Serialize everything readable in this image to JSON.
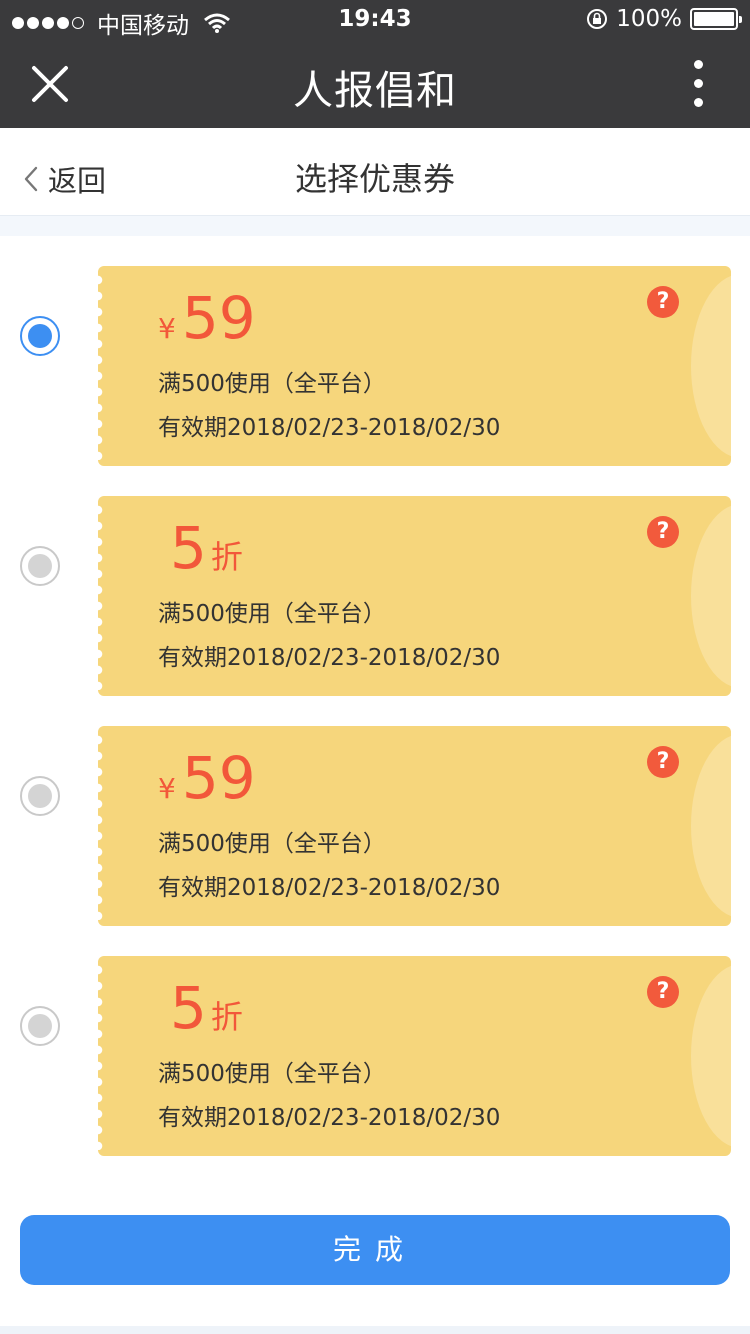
{
  "status_bar": {
    "carrier": "中国移动",
    "time": "19:43",
    "battery": "100%"
  },
  "nav": {
    "title": "人报倡和",
    "close_icon": "close-icon",
    "more_icon": "more-vertical-icon"
  },
  "sub_header": {
    "back_label": "返回",
    "title": "选择优惠券"
  },
  "coupons": [
    {
      "selected": true,
      "currency": "¥",
      "value": "59",
      "unit": "",
      "condition": "满500使用（全平台）",
      "validity": "有效期2018/02/23-2018/02/30"
    },
    {
      "selected": false,
      "currency": "",
      "value": "5",
      "unit": "折",
      "condition": "满500使用（全平台）",
      "validity": "有效期2018/02/23-2018/02/30"
    },
    {
      "selected": false,
      "currency": "¥",
      "value": "59",
      "unit": "",
      "condition": "满500使用（全平台）",
      "validity": "有效期2018/02/23-2018/02/30"
    },
    {
      "selected": false,
      "currency": "",
      "value": "5",
      "unit": "折",
      "condition": "满500使用（全平台）",
      "validity": "有效期2018/02/23-2018/02/30"
    }
  ],
  "help_symbol": "?",
  "done_label": "完成",
  "colors": {
    "bar_bg": "#3a3a3c",
    "accent_blue": "#3d8ff2",
    "coupon_bg": "#f6d67c",
    "price_red": "#f2573a"
  }
}
